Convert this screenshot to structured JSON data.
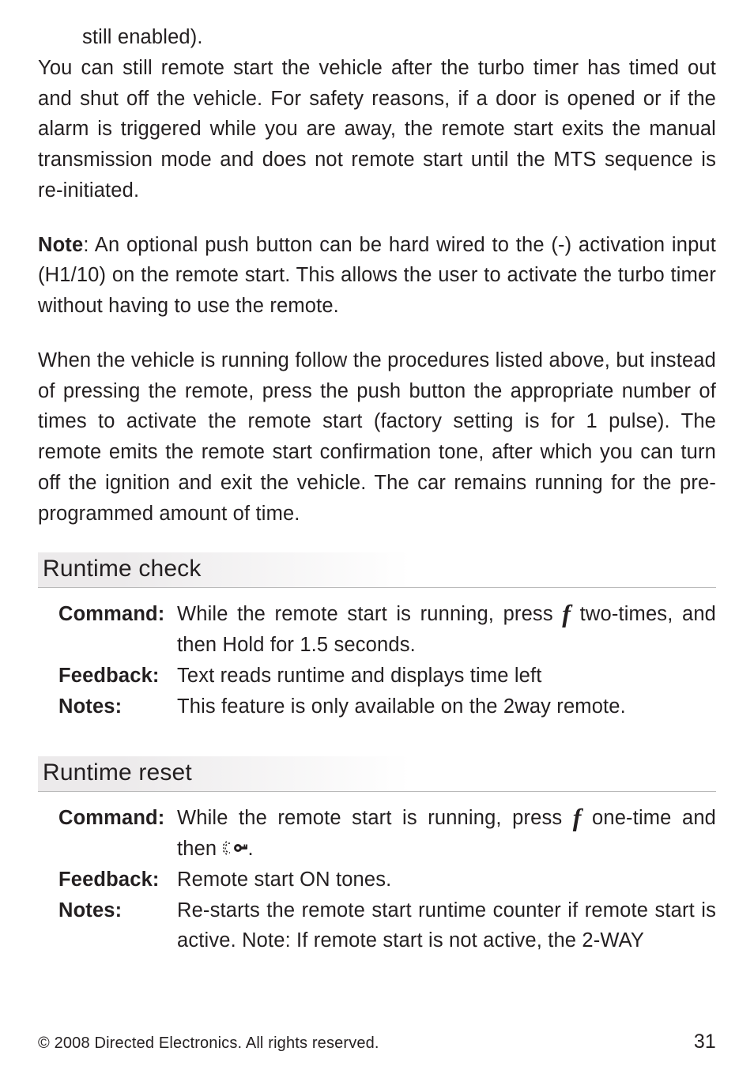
{
  "top_indent": "still enabled).",
  "para1": "You can still remote start the vehicle after the turbo timer has timed out and shut off the vehicle. For safety reasons, if a door is opened or if the alarm is triggered while you are away, the remote start exits the manual transmission mode and does not remote start until the MTS sequence is re-initiated.",
  "note_lead": "Note",
  "para2": ": An optional push button can be hard wired to the (-) activation input (H1/10) on the remote start. This allows the user to activate the turbo timer without having to use the remote.",
  "para3": "When the vehicle is running follow the procedures listed above, but instead of pressing the remote, press the push button the appropriate number of times to activate the remote start (factory setting is for 1 pulse). The remote emits the remote start confirmation tone, after which you can turn off the ignition and exit the vehicle. The car remains running for the pre-programmed amount of time.",
  "sec_check": {
    "heading": "Runtime check",
    "cmd_label": "Command",
    "cmd_a": "While the remote start is running, press ",
    "cmd_b": " two-times, and then Hold for 1.5 seconds.",
    "fb_label": "Feedback",
    "fb": "Text reads runtime and displays time left",
    "notes_label": "Notes",
    "notes": "This feature is only available on the 2way remote."
  },
  "sec_reset": {
    "heading": "Runtime reset",
    "cmd_label": "Command",
    "cmd_a": "While the remote start is running, press ",
    "cmd_b": " one-time and then ",
    "cmd_c": ".",
    "fb_label": "Feedback",
    "fb": "Remote start ON tones.",
    "notes_label": "Notes",
    "notes": "Re-starts the remote start runtime counter if remote start is active.  Note: If remote start is not active, the 2-WAY"
  },
  "footer_left": "© 2008 Directed Electronics. All rights reserved.",
  "footer_right": "31",
  "glyph_f": "f",
  "colon": ":"
}
